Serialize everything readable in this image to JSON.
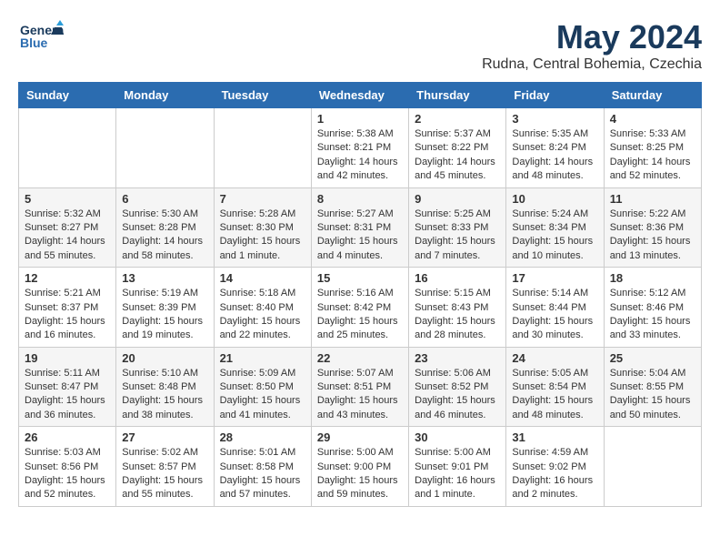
{
  "header": {
    "logo_line1": "General",
    "logo_line2": "Blue",
    "month": "May 2024",
    "location": "Rudna, Central Bohemia, Czechia"
  },
  "weekdays": [
    "Sunday",
    "Monday",
    "Tuesday",
    "Wednesday",
    "Thursday",
    "Friday",
    "Saturday"
  ],
  "weeks": [
    [
      {
        "day": "",
        "sunrise": "",
        "sunset": "",
        "daylight": ""
      },
      {
        "day": "",
        "sunrise": "",
        "sunset": "",
        "daylight": ""
      },
      {
        "day": "",
        "sunrise": "",
        "sunset": "",
        "daylight": ""
      },
      {
        "day": "1",
        "sunrise": "Sunrise: 5:38 AM",
        "sunset": "Sunset: 8:21 PM",
        "daylight": "Daylight: 14 hours and 42 minutes."
      },
      {
        "day": "2",
        "sunrise": "Sunrise: 5:37 AM",
        "sunset": "Sunset: 8:22 PM",
        "daylight": "Daylight: 14 hours and 45 minutes."
      },
      {
        "day": "3",
        "sunrise": "Sunrise: 5:35 AM",
        "sunset": "Sunset: 8:24 PM",
        "daylight": "Daylight: 14 hours and 48 minutes."
      },
      {
        "day": "4",
        "sunrise": "Sunrise: 5:33 AM",
        "sunset": "Sunset: 8:25 PM",
        "daylight": "Daylight: 14 hours and 52 minutes."
      }
    ],
    [
      {
        "day": "5",
        "sunrise": "Sunrise: 5:32 AM",
        "sunset": "Sunset: 8:27 PM",
        "daylight": "Daylight: 14 hours and 55 minutes."
      },
      {
        "day": "6",
        "sunrise": "Sunrise: 5:30 AM",
        "sunset": "Sunset: 8:28 PM",
        "daylight": "Daylight: 14 hours and 58 minutes."
      },
      {
        "day": "7",
        "sunrise": "Sunrise: 5:28 AM",
        "sunset": "Sunset: 8:30 PM",
        "daylight": "Daylight: 15 hours and 1 minute."
      },
      {
        "day": "8",
        "sunrise": "Sunrise: 5:27 AM",
        "sunset": "Sunset: 8:31 PM",
        "daylight": "Daylight: 15 hours and 4 minutes."
      },
      {
        "day": "9",
        "sunrise": "Sunrise: 5:25 AM",
        "sunset": "Sunset: 8:33 PM",
        "daylight": "Daylight: 15 hours and 7 minutes."
      },
      {
        "day": "10",
        "sunrise": "Sunrise: 5:24 AM",
        "sunset": "Sunset: 8:34 PM",
        "daylight": "Daylight: 15 hours and 10 minutes."
      },
      {
        "day": "11",
        "sunrise": "Sunrise: 5:22 AM",
        "sunset": "Sunset: 8:36 PM",
        "daylight": "Daylight: 15 hours and 13 minutes."
      }
    ],
    [
      {
        "day": "12",
        "sunrise": "Sunrise: 5:21 AM",
        "sunset": "Sunset: 8:37 PM",
        "daylight": "Daylight: 15 hours and 16 minutes."
      },
      {
        "day": "13",
        "sunrise": "Sunrise: 5:19 AM",
        "sunset": "Sunset: 8:39 PM",
        "daylight": "Daylight: 15 hours and 19 minutes."
      },
      {
        "day": "14",
        "sunrise": "Sunrise: 5:18 AM",
        "sunset": "Sunset: 8:40 PM",
        "daylight": "Daylight: 15 hours and 22 minutes."
      },
      {
        "day": "15",
        "sunrise": "Sunrise: 5:16 AM",
        "sunset": "Sunset: 8:42 PM",
        "daylight": "Daylight: 15 hours and 25 minutes."
      },
      {
        "day": "16",
        "sunrise": "Sunrise: 5:15 AM",
        "sunset": "Sunset: 8:43 PM",
        "daylight": "Daylight: 15 hours and 28 minutes."
      },
      {
        "day": "17",
        "sunrise": "Sunrise: 5:14 AM",
        "sunset": "Sunset: 8:44 PM",
        "daylight": "Daylight: 15 hours and 30 minutes."
      },
      {
        "day": "18",
        "sunrise": "Sunrise: 5:12 AM",
        "sunset": "Sunset: 8:46 PM",
        "daylight": "Daylight: 15 hours and 33 minutes."
      }
    ],
    [
      {
        "day": "19",
        "sunrise": "Sunrise: 5:11 AM",
        "sunset": "Sunset: 8:47 PM",
        "daylight": "Daylight: 15 hours and 36 minutes."
      },
      {
        "day": "20",
        "sunrise": "Sunrise: 5:10 AM",
        "sunset": "Sunset: 8:48 PM",
        "daylight": "Daylight: 15 hours and 38 minutes."
      },
      {
        "day": "21",
        "sunrise": "Sunrise: 5:09 AM",
        "sunset": "Sunset: 8:50 PM",
        "daylight": "Daylight: 15 hours and 41 minutes."
      },
      {
        "day": "22",
        "sunrise": "Sunrise: 5:07 AM",
        "sunset": "Sunset: 8:51 PM",
        "daylight": "Daylight: 15 hours and 43 minutes."
      },
      {
        "day": "23",
        "sunrise": "Sunrise: 5:06 AM",
        "sunset": "Sunset: 8:52 PM",
        "daylight": "Daylight: 15 hours and 46 minutes."
      },
      {
        "day": "24",
        "sunrise": "Sunrise: 5:05 AM",
        "sunset": "Sunset: 8:54 PM",
        "daylight": "Daylight: 15 hours and 48 minutes."
      },
      {
        "day": "25",
        "sunrise": "Sunrise: 5:04 AM",
        "sunset": "Sunset: 8:55 PM",
        "daylight": "Daylight: 15 hours and 50 minutes."
      }
    ],
    [
      {
        "day": "26",
        "sunrise": "Sunrise: 5:03 AM",
        "sunset": "Sunset: 8:56 PM",
        "daylight": "Daylight: 15 hours and 52 minutes."
      },
      {
        "day": "27",
        "sunrise": "Sunrise: 5:02 AM",
        "sunset": "Sunset: 8:57 PM",
        "daylight": "Daylight: 15 hours and 55 minutes."
      },
      {
        "day": "28",
        "sunrise": "Sunrise: 5:01 AM",
        "sunset": "Sunset: 8:58 PM",
        "daylight": "Daylight: 15 hours and 57 minutes."
      },
      {
        "day": "29",
        "sunrise": "Sunrise: 5:00 AM",
        "sunset": "Sunset: 9:00 PM",
        "daylight": "Daylight: 15 hours and 59 minutes."
      },
      {
        "day": "30",
        "sunrise": "Sunrise: 5:00 AM",
        "sunset": "Sunset: 9:01 PM",
        "daylight": "Daylight: 16 hours and 1 minute."
      },
      {
        "day": "31",
        "sunrise": "Sunrise: 4:59 AM",
        "sunset": "Sunset: 9:02 PM",
        "daylight": "Daylight: 16 hours and 2 minutes."
      },
      {
        "day": "",
        "sunrise": "",
        "sunset": "",
        "daylight": ""
      }
    ]
  ]
}
